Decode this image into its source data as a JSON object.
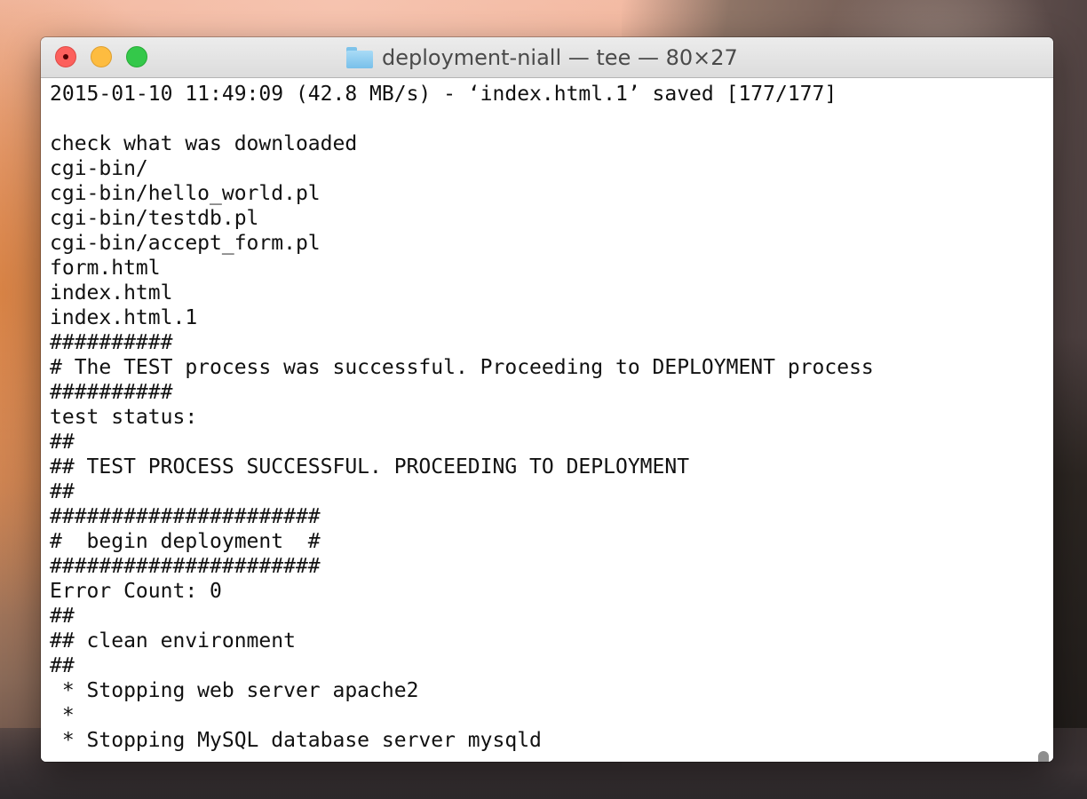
{
  "window": {
    "title": "deployment-niall — tee — 80×27",
    "folder_icon": "folder-icon"
  },
  "titlebar": {
    "buttons": [
      {
        "name": "close",
        "icon": "close-icon",
        "color": "#fc605c"
      },
      {
        "name": "minimize",
        "icon": "minimize-icon",
        "color": "#fdbc40"
      },
      {
        "name": "zoom",
        "icon": "zoom-icon",
        "color": "#34c84a"
      }
    ]
  },
  "terminal": {
    "lines": [
      "2015-01-10 11:49:09 (42.8 MB/s) - ‘index.html.1’ saved [177/177]",
      "",
      "check what was downloaded",
      "cgi-bin/",
      "cgi-bin/hello_world.pl",
      "cgi-bin/testdb.pl",
      "cgi-bin/accept_form.pl",
      "form.html",
      "index.html",
      "index.html.1",
      "##########",
      "# The TEST process was successful. Proceeding to DEPLOYMENT process",
      "##########",
      "test status:",
      "##",
      "## TEST PROCESS SUCCESSFUL. PROCEEDING TO DEPLOYMENT",
      "##",
      "######################",
      "#  begin deployment  #",
      "######################",
      "Error Count: 0",
      "##",
      "## clean environment",
      "##",
      " * Stopping web server apache2",
      " *",
      " * Stopping MySQL database server mysqld"
    ]
  }
}
